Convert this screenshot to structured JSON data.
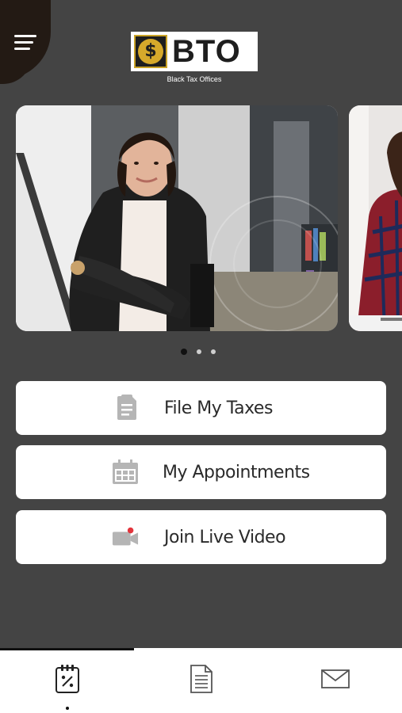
{
  "header": {
    "menu_icon": "hamburger-menu-icon",
    "logo_mark": "$",
    "logo_text": "BTO",
    "logo_subtitle": "Black Tax Offices"
  },
  "carousel": {
    "slides": [
      "business-woman-photo",
      "woman-at-laptop-photo"
    ],
    "active_index": 0,
    "page_count": 3
  },
  "actions": [
    {
      "label": "File My Taxes",
      "icon": "document-icon"
    },
    {
      "label": "My Appointments",
      "icon": "calendar-icon"
    },
    {
      "label": "Join Live Video",
      "icon": "video-camera-icon"
    }
  ],
  "tabs": [
    {
      "icon": "tax-clipboard-icon",
      "active": true
    },
    {
      "icon": "document-icon",
      "active": false
    },
    {
      "icon": "mail-icon",
      "active": false
    }
  ],
  "colors": {
    "background": "#444444",
    "menu_blob": "#231a14",
    "logo_gold": "#d6a92b",
    "button_bg": "#ffffff",
    "icon_gray": "#b5b5b5"
  }
}
